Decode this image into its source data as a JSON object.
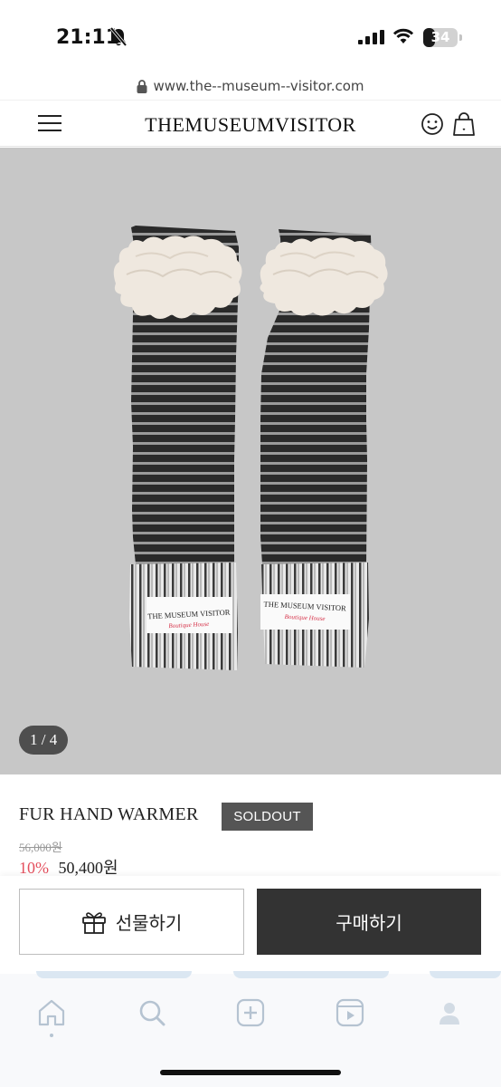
{
  "status_bar": {
    "time": "21:11",
    "battery_level": "34",
    "battery_fraction": 0.34,
    "icons": [
      "bell-slash-icon",
      "signal-icon",
      "wifi-icon",
      "battery-icon"
    ]
  },
  "browser": {
    "url": "www.the--museum--visitor.com"
  },
  "header": {
    "logo": "THEMUSEUMVISITOR",
    "icons": [
      "menu-icon",
      "smile-icon",
      "shopping-bag-icon"
    ]
  },
  "gallery": {
    "counter": "1 / 4",
    "label_line1": "THE MUSEUM VISITOR",
    "label_line2": "Boutique House"
  },
  "product": {
    "title": "FUR HAND WARMER",
    "badge": "SOLDOUT",
    "original_price": "56,000원",
    "discount": "10%",
    "sale_price": "50,400원"
  },
  "actions": {
    "gift_label": "선물하기",
    "buy_label": "구매하기"
  },
  "colors": {
    "discount": "#e4505e",
    "buy_button": "#333333",
    "gallery_bg": "#c7c7c7"
  }
}
